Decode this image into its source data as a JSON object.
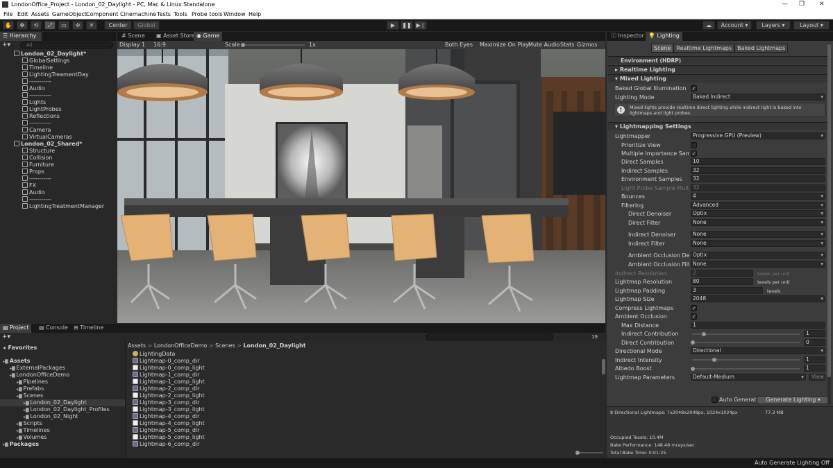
{
  "window": {
    "title": "LondonOffice_Project - London_02_Daylight - PC, Mac & Linux Standalone",
    "controls": [
      "—",
      "❐",
      "✕"
    ]
  },
  "menu": [
    "File",
    "Edit",
    "Assets",
    "GameObject",
    "Component",
    "Cinemachine",
    "Tests",
    "Tools",
    "Probe tools",
    "Window",
    "Help"
  ],
  "toolbar": {
    "center": "Center",
    "global": "Global",
    "account": "Account",
    "layers": "Layers",
    "layout": "Layout"
  },
  "hierarchy": {
    "tab": "Hierarchy",
    "search_placeholder": "All",
    "rows": [
      {
        "label": "London_02_Daylight*",
        "kind": "scene",
        "indent": 0
      },
      {
        "label": "GlobalSettings",
        "indent": 1
      },
      {
        "label": "Timeline",
        "indent": 1
      },
      {
        "label": "LightingTreamentDay",
        "indent": 1
      },
      {
        "label": "-----------",
        "indent": 1
      },
      {
        "label": "Audio",
        "indent": 1
      },
      {
        "label": "-----------",
        "indent": 1
      },
      {
        "label": "Lights",
        "indent": 1
      },
      {
        "label": "LightProbes",
        "indent": 1
      },
      {
        "label": "Reflections",
        "indent": 1
      },
      {
        "label": "-----------",
        "indent": 1
      },
      {
        "label": "Camera",
        "indent": 1
      },
      {
        "label": "VirtualCameras",
        "indent": 1
      },
      {
        "label": "London_02_Shared*",
        "kind": "scene",
        "indent": 0
      },
      {
        "label": "Structure",
        "indent": 1
      },
      {
        "label": "Collision",
        "indent": 1
      },
      {
        "label": "Furniture",
        "indent": 1
      },
      {
        "label": "Props",
        "indent": 1
      },
      {
        "label": "-----------",
        "indent": 1
      },
      {
        "label": "FX",
        "indent": 1
      },
      {
        "label": "Audio",
        "indent": 1
      },
      {
        "label": "-----------",
        "indent": 1
      },
      {
        "label": "LightingTreatmentManager",
        "indent": 1
      }
    ]
  },
  "viewport": {
    "tabs": [
      "Scene",
      "Asset Store",
      "Game"
    ],
    "display": "Display 1",
    "aspect": "16:9",
    "scale_label": "Scale",
    "scale_value": "1x",
    "options": [
      "Both Eyes",
      "Maximize On Play",
      "Mute Audio",
      "Stats",
      "Gizmos"
    ]
  },
  "project": {
    "tabs": [
      "Project",
      "Console",
      "Timeline"
    ],
    "count": "19",
    "tree": [
      {
        "label": "Favorites",
        "indent": 0,
        "bold": true
      },
      {
        "label": "Assets",
        "indent": 0,
        "bold": true
      },
      {
        "label": "ExternalPackages",
        "indent": 1
      },
      {
        "label": "LondonOfficeDemo",
        "indent": 1
      },
      {
        "label": "Pipelines",
        "indent": 2
      },
      {
        "label": "Prefabs",
        "indent": 2
      },
      {
        "label": "Scenes",
        "indent": 2
      },
      {
        "label": "London_02_Daylight",
        "indent": 3,
        "selected": true
      },
      {
        "label": "London_02_Daylight_Profiles",
        "indent": 3
      },
      {
        "label": "London_02_Night",
        "indent": 3
      },
      {
        "label": "Scripts",
        "indent": 2
      },
      {
        "label": "Timelines",
        "indent": 2
      },
      {
        "label": "Volumes",
        "indent": 2
      },
      {
        "label": "Packages",
        "indent": 0,
        "bold": true
      }
    ],
    "breadcrumb": [
      "Assets",
      "LondonOfficeDemo",
      "Scenes",
      "London_02_Daylight"
    ],
    "files": [
      "LightingData",
      "Lightmap-0_comp_dir",
      "Lightmap-0_comp_light",
      "Lightmap-1_comp_dir",
      "Lightmap-1_comp_light",
      "Lightmap-2_comp_dir",
      "Lightmap-2_comp_light",
      "Lightmap-3_comp_dir",
      "Lightmap-3_comp_light",
      "Lightmap-4_comp_dir",
      "Lightmap-4_comp_light",
      "Lightmap-5_comp_dir",
      "Lightmap-5_comp_light",
      "Lightmap-6_comp_dir"
    ]
  },
  "inspector": {
    "tabs": [
      "Inspector",
      "Lighting"
    ],
    "subtabs": [
      "Scene",
      "Realtime Lightmaps",
      "Baked Lightmaps"
    ],
    "env": "Environment (HDRP)",
    "realtime": "Realtime Lighting",
    "mixed": "Mixed Lighting",
    "baked_gi": "Baked Global Illumination",
    "lighting_mode_label": "Lighting Mode",
    "lighting_mode": "Baked Indirect",
    "info": "Mixed lights provide realtime direct lighting while indirect light is baked into lightmaps and light probes",
    "lm_settings": "Lightmapping Settings",
    "fields": {
      "lightmapper": [
        "Lightmapper",
        "Progressive GPU (Preview)"
      ],
      "prioritize": "Prioritize View",
      "mis": "Multiple Importance Sampling",
      "direct_samples": [
        "Direct Samples",
        "10"
      ],
      "indirect_samples": [
        "Indirect Samples",
        "32"
      ],
      "env_samples": [
        "Environment Samples",
        "32"
      ],
      "lp_samples": [
        "Light Probe Sample Multiplier",
        "32"
      ],
      "bounces": [
        "Bounces",
        "4"
      ],
      "filtering": [
        "Filtering",
        "Advanced"
      ],
      "direct_denoiser": [
        "Direct Denoiser",
        "Optix"
      ],
      "direct_filter": [
        "Direct Filter",
        "None"
      ],
      "indirect_denoiser": [
        "Indirect Denoiser",
        "None"
      ],
      "indirect_filter": [
        "Indirect Filter",
        "None"
      ],
      "ao_denoiser": [
        "Ambient Occlusion Denoiser",
        "Optix"
      ],
      "ao_filter": [
        "Ambient Occlusion Filter",
        "None"
      ],
      "indirect_res": [
        "Indirect Resolution",
        "2",
        "texels per unit"
      ],
      "lm_res": [
        "Lightmap Resolution",
        "80",
        "texels per unit"
      ],
      "lm_pad": [
        "Lightmap Padding",
        "3",
        "texels"
      ],
      "lm_size": [
        "Lightmap Size",
        "2048"
      ],
      "compress": "Compress Lightmaps",
      "ao": "Ambient Occlusion",
      "max_dist": [
        "Max Distance",
        "1"
      ],
      "ind_contrib": [
        "Indirect Contribution",
        "1"
      ],
      "dir_contrib": [
        "Direct Contribution",
        "0"
      ],
      "dir_mode": [
        "Directional Mode",
        "Directional"
      ],
      "ind_int": [
        "Indirect Intensity",
        "1"
      ],
      "albedo": [
        "Albedo Boost",
        "1"
      ],
      "params": [
        "Lightmap Parameters",
        "Default-Medium"
      ],
      "view": "View"
    },
    "auto_generate": "Auto Generate",
    "generate": "Generate Lighting",
    "stats": {
      "maps": "8 Directional Lightmaps: 7x2048x2048px, 1024x1024px",
      "size": "77.3 MB",
      "texels": "Occupied Texels: 10.4M",
      "perf": "Bake Performance: 148.48 mrays/sec",
      "time": "Total Bake Time: 0:01:25"
    }
  },
  "status": "Auto Generate Lighting Off"
}
